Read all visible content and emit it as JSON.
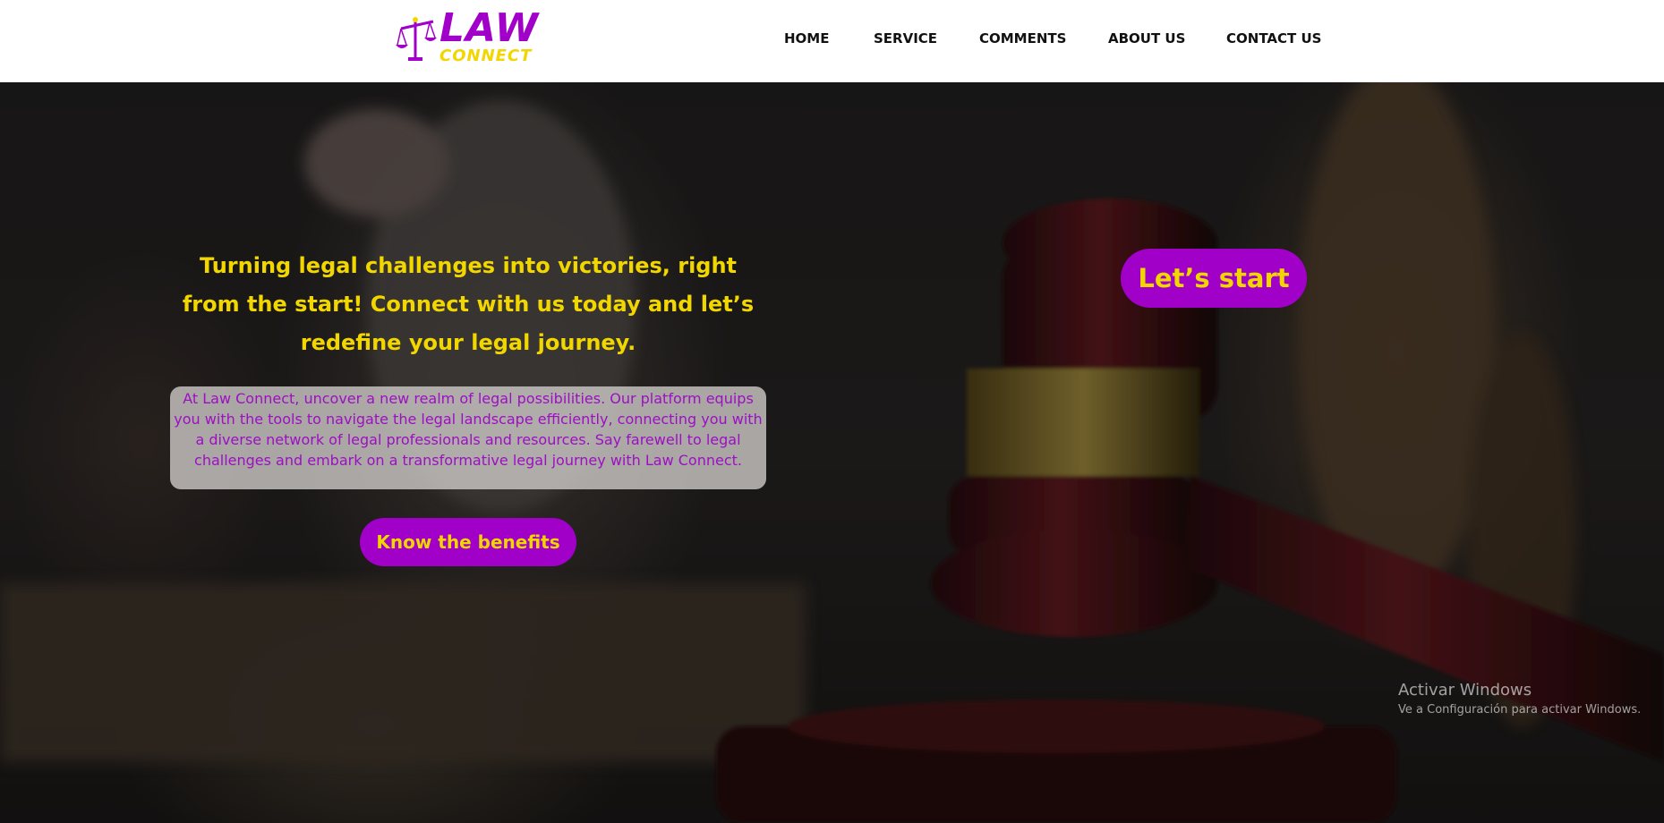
{
  "brand": {
    "name_top": "LAW",
    "name_bottom": "CONNECT",
    "primary_color": "#a100c8",
    "accent_color": "#f2d600",
    "logo_icon": "scales-of-justice-icon"
  },
  "nav": {
    "items": [
      {
        "label": "HOME"
      },
      {
        "label": "SERVICE"
      },
      {
        "label": "COMMENTS"
      },
      {
        "label": "ABOUT US"
      },
      {
        "label": "CONTACT US"
      }
    ]
  },
  "hero": {
    "title": "Turning legal challenges into victories, right from the start! Connect with us today and let’s redefine your legal journey.",
    "description": "At Law Connect, uncover a new realm of legal possibilities. Our platform equips you with the tools to navigate the legal landscape efficiently, connecting you with a diverse network of legal professionals and resources. Say farewell to legal challenges and embark on a transformative legal journey with Law Connect.",
    "benefits_button": "Know the benefits",
    "start_button": "Let’s start",
    "background_image": "gavel-and-lady-justice-photo"
  },
  "os_watermark": {
    "title": "Activar Windows",
    "subtitle": "Ve a Configuración para activar Windows."
  }
}
